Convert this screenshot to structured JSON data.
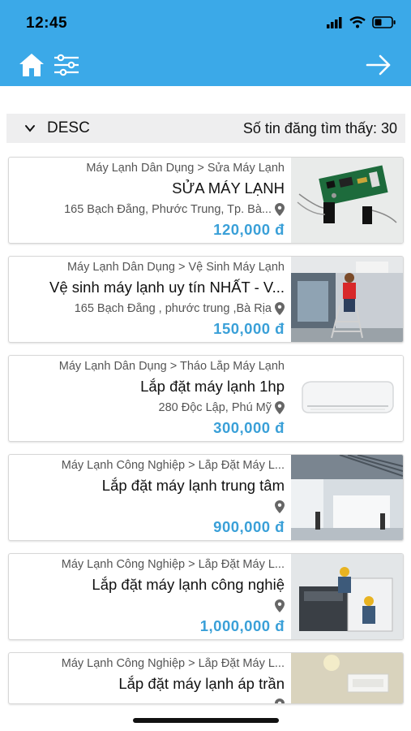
{
  "status_bar": {
    "time": "12:45"
  },
  "header": {
    "icons": [
      "home-icon",
      "filter-sliders-icon",
      "arrow-right-icon"
    ],
    "accent_color": "#3ba9e8"
  },
  "sort_bar": {
    "order": "DESC",
    "count_text": "Số tin đăng tìm thấy: 30"
  },
  "listings": [
    {
      "category": "Máy Lạnh Dân Dụng > Sửa Máy Lạnh",
      "title": "SỬA MÁY LẠNH",
      "address": "165 Bạch Đằng, Phước Trung, Tp. Bà...",
      "price": "120,000 đ",
      "image": "circuit-board"
    },
    {
      "category": "Máy Lạnh Dân Dụng > Vệ Sinh Máy Lạnh",
      "title": "Vệ sinh máy lạnh uy tín NHẤT - V...",
      "address": "165 Bạch Đằng , phước trung ,Bà Rịa",
      "price": "150,000 đ",
      "image": "technician-ladder"
    },
    {
      "category": "Máy Lạnh Dân Dụng > Tháo Lắp Máy Lạnh",
      "title": "Lắp đặt máy lạnh 1hp",
      "address": "280 Độc Lập, Phú Mỹ",
      "price": "300,000 đ",
      "image": "wall-ac-unit"
    },
    {
      "category": "Máy Lạnh Công Nghiệp > Lắp Đặt Máy L...",
      "title": "Lắp đặt máy lạnh trung tâm",
      "address": "",
      "price": "900,000 đ",
      "image": "office-ceiling"
    },
    {
      "category": "Máy Lạnh Công Nghiệp > Lắp Đặt Máy L...",
      "title": "Lắp đặt máy lạnh công nghiệ",
      "address": "",
      "price": "1,000,000 đ",
      "image": "industrial-install"
    },
    {
      "category": "Máy Lạnh Công Nghiệp > Lắp Đặt Máy L...",
      "title": "Lắp đặt máy lạnh áp trần",
      "address": "",
      "price": "",
      "image": "ceiling-cassette"
    }
  ],
  "colors": {
    "price": "#3aa0d8",
    "sort_bar_bg": "#eeeeef"
  }
}
